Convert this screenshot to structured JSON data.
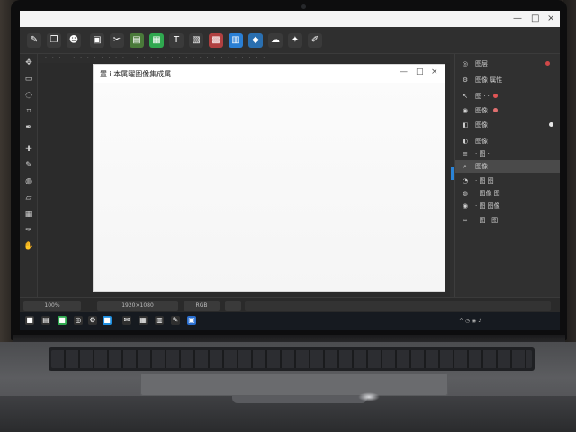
{
  "titlebar": {
    "app_title": "— □ ×",
    "minimize": "—",
    "maximize": "□",
    "close": "×"
  },
  "toolbar": {
    "tools": [
      {
        "icon": "brush-icon",
        "glyph": "✎",
        "color": "#3a3a3a"
      },
      {
        "icon": "copy-icon",
        "glyph": "❐",
        "color": "#3a3a3a"
      },
      {
        "icon": "user-icon",
        "glyph": "☻",
        "color": "#3a3a3a"
      },
      {
        "icon": "image-icon",
        "glyph": "▣",
        "color": "#3a3a3a"
      },
      {
        "icon": "scissors-icon",
        "glyph": "✂",
        "color": "#3a3a3a"
      },
      {
        "icon": "layer-icon",
        "glyph": "▤",
        "color": "#4a7a3a"
      },
      {
        "icon": "green-doc-icon",
        "glyph": "▦",
        "color": "#2fa84f"
      },
      {
        "icon": "text-icon",
        "glyph": "T",
        "color": "#3a3a3a"
      },
      {
        "icon": "picture-icon",
        "glyph": "▧",
        "color": "#3a3a3a"
      },
      {
        "icon": "red-doc-icon",
        "glyph": "▩",
        "color": "#b04040"
      },
      {
        "icon": "blue-doc-icon",
        "glyph": "▥",
        "color": "#2a7fd4"
      },
      {
        "icon": "shapes-icon",
        "glyph": "◆",
        "color": "#2a6fb0"
      },
      {
        "icon": "cloud-icon",
        "glyph": "☁",
        "color": "#3a3a3a"
      },
      {
        "icon": "tag-icon",
        "glyph": "✦",
        "color": "#3a3a3a"
      },
      {
        "icon": "pencil-icon",
        "glyph": "✐",
        "color": "#3a3a3a"
      }
    ]
  },
  "toolbox": {
    "icons": [
      "move-icon",
      "marquee-icon",
      "lasso-icon",
      "crop-icon",
      "eyedropper-icon",
      "heal-icon",
      "brush-tool-icon",
      "stamp-icon",
      "eraser-icon",
      "gradient-icon",
      "pen-icon",
      "hand-icon"
    ],
    "glyphs": [
      "✥",
      "▭",
      "◌",
      "⌗",
      "✒",
      "✚",
      "✎",
      "◍",
      "▱",
      "▦",
      "✑",
      "✋"
    ]
  },
  "dialog": {
    "title": "置 i 本属曜图像集成属",
    "minimize": "—",
    "maximize": "□",
    "close": "×"
  },
  "panel": {
    "rows": [
      {
        "icon": "palette-icon",
        "glyph": "◎",
        "label": "图层",
        "selected": false
      },
      {
        "icon": "settings-icon",
        "glyph": "⚙",
        "label": "图像 属性",
        "selected": false
      },
      {
        "icon": "cursor-icon",
        "glyph": "↖",
        "label": "图 · ·",
        "selected": false
      },
      {
        "icon": "camera-icon",
        "glyph": "◉",
        "label": "图像",
        "selected": false
      },
      {
        "icon": "bookmark-icon",
        "glyph": "◧",
        "label": "图像",
        "selected": false
      },
      {
        "icon": "gradient-panel-icon",
        "glyph": "◐",
        "label": "图像",
        "selected": false
      },
      {
        "icon": "list-icon",
        "glyph": "≡",
        "label": "· 图 ·",
        "selected": false
      },
      {
        "icon": "search-icon",
        "glyph": "⌕",
        "label": "图像",
        "selected": true
      },
      {
        "icon": "eye-icon",
        "glyph": "◔",
        "label": "· 图 图",
        "selected": false
      },
      {
        "icon": "globe-icon",
        "glyph": "◍",
        "label": "· 图像 图",
        "selected": false
      },
      {
        "icon": "eye-visible-icon",
        "glyph": "◉",
        "label": "· 图 图像",
        "selected": false
      },
      {
        "icon": "link-icon",
        "glyph": "∞",
        "label": "· 图 · 图",
        "selected": false
      }
    ]
  },
  "statusbar": {
    "zoom": "100%",
    "size": "1920×1080",
    "mode": "RGB"
  },
  "taskbar": {
    "icons": [
      {
        "icon": "start-icon",
        "glyph": "■",
        "color": "#3a3a3a"
      },
      {
        "icon": "files-icon",
        "glyph": "▤",
        "color": "#2f2f2f"
      },
      {
        "icon": "green-app-icon",
        "glyph": "■",
        "color": "#2fa84f"
      },
      {
        "icon": "chrome-icon",
        "glyph": "◎",
        "color": "#2f2f2f"
      },
      {
        "icon": "gear-task-icon",
        "glyph": "⚙",
        "color": "#2f2f2f"
      },
      {
        "icon": "blue-app-icon",
        "glyph": "■",
        "color": "#1e8fe1"
      },
      {
        "icon": "mail-icon",
        "glyph": "✉",
        "color": "#2f2f2f"
      },
      {
        "icon": "doc-task-icon",
        "glyph": "▦",
        "color": "#2f2f2f"
      },
      {
        "icon": "note-icon",
        "glyph": "▥",
        "color": "#2f2f2f"
      },
      {
        "icon": "edit-task-icon",
        "glyph": "✎",
        "color": "#2f2f2f"
      },
      {
        "icon": "photo-app-icon",
        "glyph": "▣",
        "color": "#2a6fd0"
      }
    ],
    "tray_text": "^ ◔ ◉ ♪"
  },
  "colors": {
    "accent": "#2a84d8",
    "panel_bg": "#303030",
    "toolbar_bg": "#2f2f2f",
    "dialog_bg": "#ffffff",
    "taskbar_bg": "#161a20",
    "red_dot": "#e05555"
  }
}
